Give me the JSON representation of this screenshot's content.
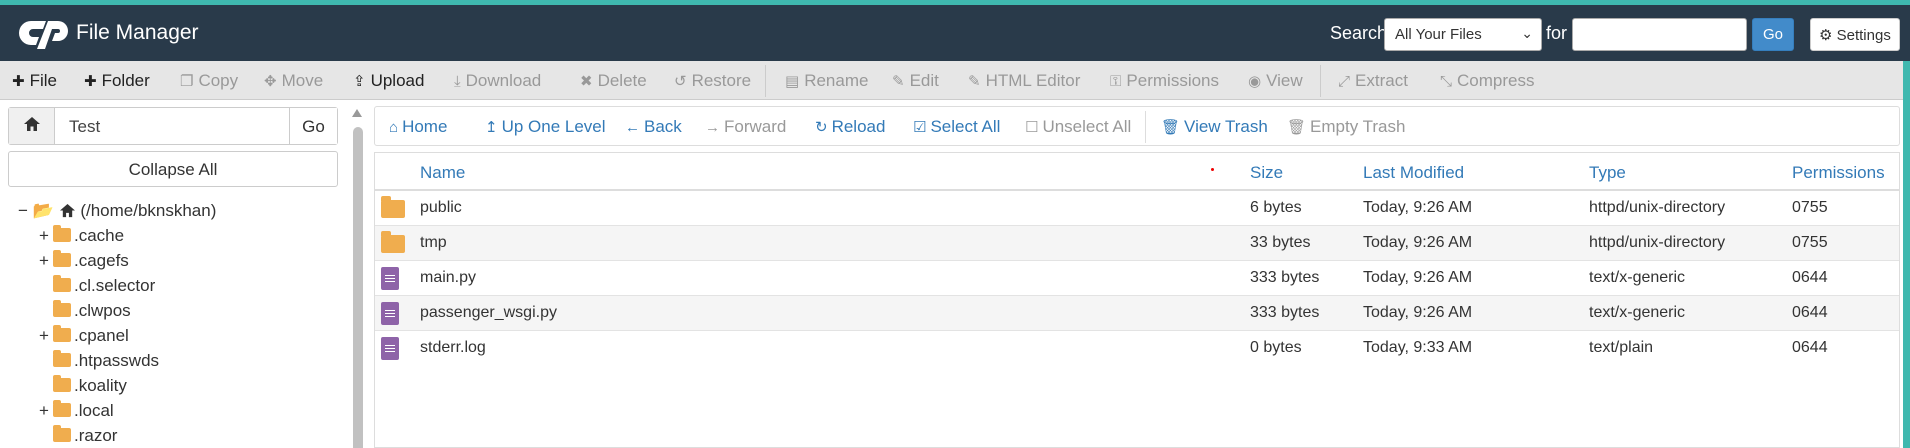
{
  "header": {
    "app_title": "File Manager",
    "search_label": "Search",
    "search_scope": "All Your Files",
    "for_label": "for",
    "search_value": "",
    "go_label": "Go",
    "settings_label": "Settings"
  },
  "toolbar": {
    "file": "File",
    "folder": "Folder",
    "copy": "Copy",
    "move": "Move",
    "upload": "Upload",
    "download": "Download",
    "delete": "Delete",
    "restore": "Restore",
    "rename": "Rename",
    "edit": "Edit",
    "html_editor": "HTML Editor",
    "permissions": "Permissions",
    "view": "View",
    "extract": "Extract",
    "compress": "Compress"
  },
  "sidebar": {
    "path_value": "Test",
    "path_go": "Go",
    "collapse_all": "Collapse All",
    "root": "(/home/bknskhan)",
    "tree": [
      ".cache",
      ".cagefs",
      ".cl.selector",
      ".clwpos",
      ".cpanel",
      ".htpasswds",
      ".koality",
      ".local",
      ".razor"
    ]
  },
  "navbar": {
    "home": "Home",
    "up_one_level": "Up One Level",
    "back": "Back",
    "forward": "Forward",
    "reload": "Reload",
    "select_all": "Select All",
    "unselect_all": "Unselect All",
    "view_trash": "View Trash",
    "empty_trash": "Empty Trash"
  },
  "table": {
    "columns": [
      "Name",
      "Size",
      "Last Modified",
      "Type",
      "Permissions"
    ],
    "rows": [
      {
        "name": "public",
        "size": "6 bytes",
        "modified": "Today, 9:26 AM",
        "type": "httpd/unix-directory",
        "perms": "0755"
      },
      {
        "name": "tmp",
        "size": "33 bytes",
        "modified": "Today, 9:26 AM",
        "type": "httpd/unix-directory",
        "perms": "0755"
      },
      {
        "name": "main.py",
        "size": "333 bytes",
        "modified": "Today, 9:26 AM",
        "type": "text/x-generic",
        "perms": "0644"
      },
      {
        "name": "passenger_wsgi.py",
        "size": "333 bytes",
        "modified": "Today, 9:26 AM",
        "type": "text/x-generic",
        "perms": "0644"
      },
      {
        "name": "stderr.log",
        "size": "0 bytes",
        "modified": "Today, 9:33 AM",
        "type": "text/plain",
        "perms": "0644"
      }
    ]
  },
  "colors": {
    "header_bg": "#293a4a",
    "accent": "#3fb8af",
    "link": "#337ab7",
    "folder": "#f0ad4e",
    "file": "#8e63a8"
  }
}
